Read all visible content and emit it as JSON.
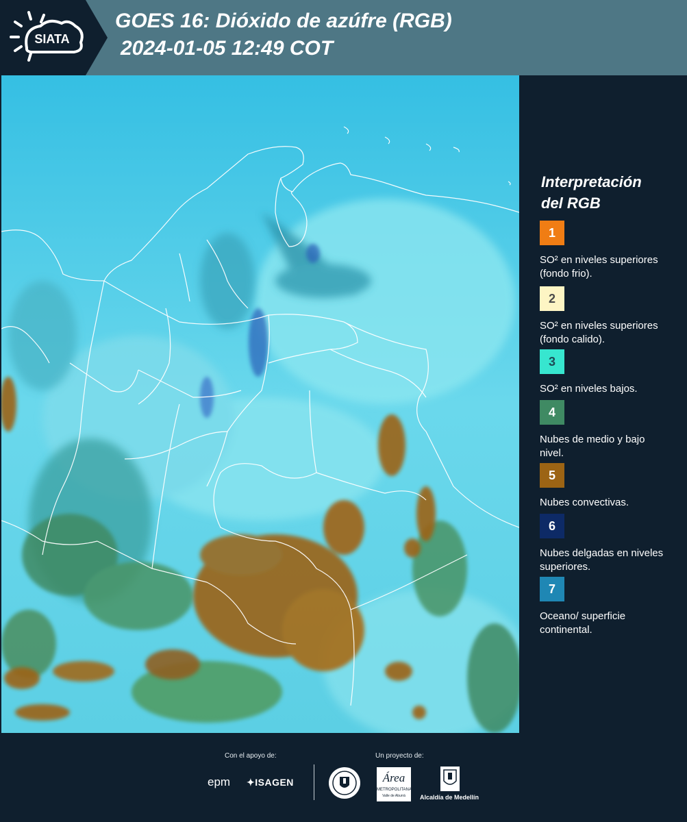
{
  "header": {
    "title_line1": "GOES 16: Dióxido de azúfre (RGB)",
    "title_line2": "2024-01-05 12:49 COT",
    "brand": "SIATA"
  },
  "legend": {
    "title_line1": "Interpretación",
    "title_line2": "del RGB",
    "items": [
      {
        "number": "1",
        "color": "#f07d14",
        "number_color": "#ffffff",
        "text": "SO² en niveles superiores (fondo frio)."
      },
      {
        "number": "2",
        "color": "#fdf5c4",
        "number_color": "#4a4a4a",
        "text": "SO² en niveles superiores (fondo calido)."
      },
      {
        "number": "3",
        "color": "#37e6cf",
        "number_color": "#1e4a55",
        "text": "SO² en niveles bajos."
      },
      {
        "number": "4",
        "color": "#3f8a63",
        "number_color": "#ffffff",
        "text": "Nubes de medio y bajo nivel."
      },
      {
        "number": "5",
        "color": "#9c6414",
        "number_color": "#ffffff",
        "text": "Nubes convectivas."
      },
      {
        "number": "6",
        "color": "#0d2a66",
        "number_color": "#ffffff",
        "text": "Nubes delgadas en niveles superiores."
      },
      {
        "number": "7",
        "color": "#1f87b4",
        "number_color": "#ffffff",
        "text": "Oceano/ superficie continental."
      }
    ]
  },
  "footer": {
    "support_label": "Con el apoyo de:",
    "project_label": "Un proyecto de:",
    "sponsor1": "epm",
    "sponsor2": "ISAGEN",
    "partner_area_line1": "Área",
    "partner_area_line2": "METROPOLITANA",
    "partner_area_line3": "Valle de Aburrá",
    "partner_alcaldia": "Alcaldía de Medellín"
  }
}
